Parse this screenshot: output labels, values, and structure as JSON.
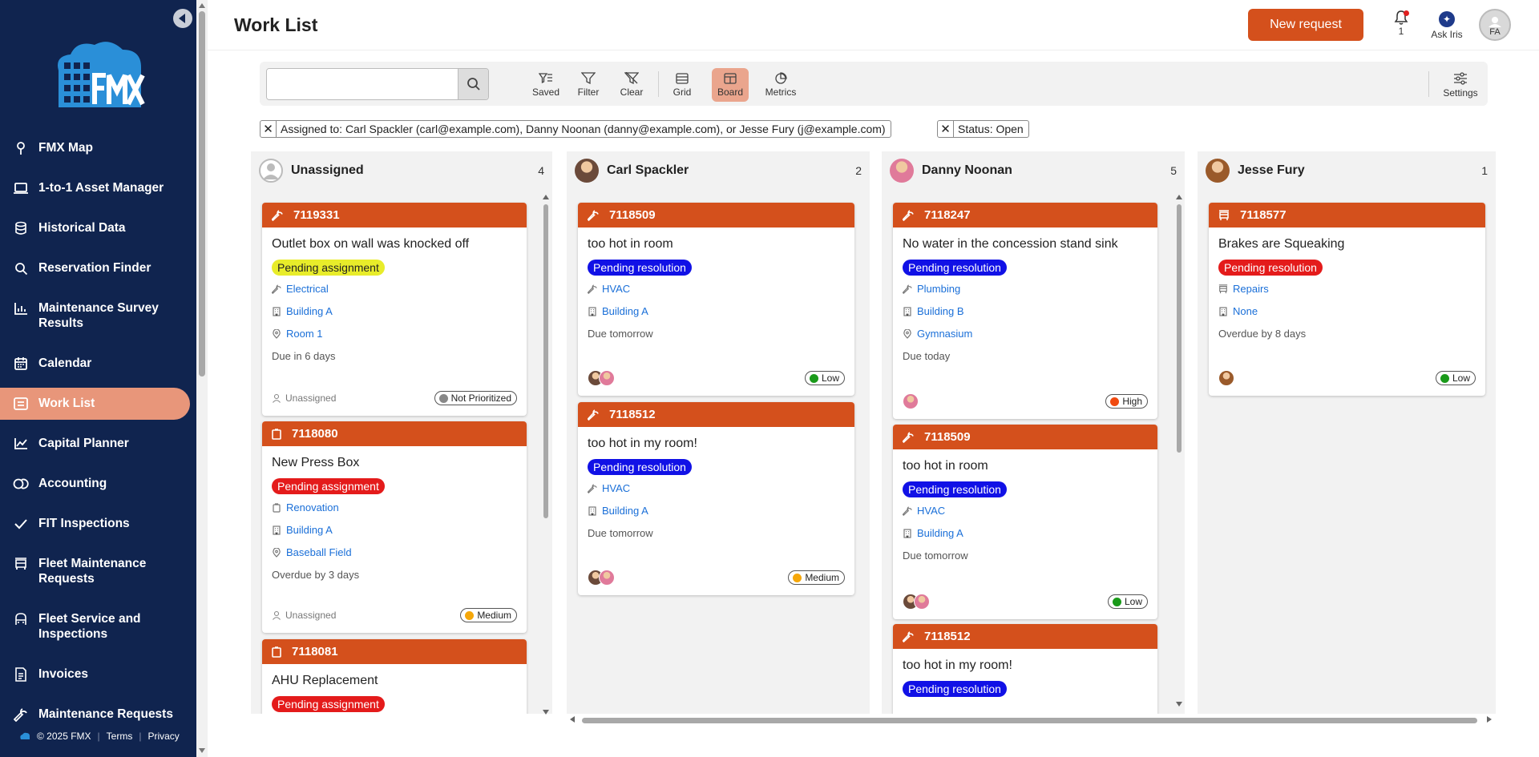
{
  "app": {
    "title": "Work List"
  },
  "sidebar": {
    "items": [
      {
        "label": "FMX Map",
        "icon": "map-pin-icon"
      },
      {
        "label": "1-to-1 Asset Manager",
        "icon": "laptop-icon"
      },
      {
        "label": "Historical Data",
        "icon": "database-icon"
      },
      {
        "label": "Reservation Finder",
        "icon": "search-icon"
      },
      {
        "label": "Maintenance Survey Results",
        "icon": "bar-chart-icon"
      },
      {
        "label": "Calendar",
        "icon": "calendar-icon"
      },
      {
        "label": "Work List",
        "icon": "list-icon",
        "active": true
      },
      {
        "label": "Capital Planner",
        "icon": "line-chart-icon"
      },
      {
        "label": "Accounting",
        "icon": "coins-icon"
      },
      {
        "label": "FIT Inspections",
        "icon": "check-icon"
      },
      {
        "label": "Fleet Maintenance Requests",
        "icon": "bus-icon"
      },
      {
        "label": "Fleet Service and Inspections",
        "icon": "vehicle-icon"
      },
      {
        "label": "Invoices",
        "icon": "invoice-icon"
      },
      {
        "label": "Maintenance Requests",
        "icon": "wrench-icon"
      }
    ],
    "footer": {
      "copyright": "© 2025 FMX",
      "terms": "Terms",
      "privacy": "Privacy"
    }
  },
  "header": {
    "new_request": "New request",
    "notifications_count": "1",
    "ask_iris": "Ask Iris",
    "user_initials": "FA"
  },
  "toolbar": {
    "search_placeholder": "",
    "saved": "Saved",
    "filter": "Filter",
    "clear": "Clear",
    "grid": "Grid",
    "board": "Board",
    "metrics": "Metrics",
    "settings": "Settings"
  },
  "filters": [
    "Assigned to: Carl Spackler (carl@example.com), Danny Noonan (danny@example.com), or Jesse Fury (j@example.com)",
    "Status: Open"
  ],
  "columns": [
    {
      "name": "Unassigned",
      "count": "4",
      "cards": [
        {
          "id": "7119331",
          "title": "Outlet box on wall was knocked off",
          "status": "Pending assignment",
          "status_color": "yellow",
          "type": "Electrical",
          "building": "Building A",
          "location": "Room 1",
          "due": "Due in 6 days",
          "assignee": "Unassigned",
          "priority": "Not Prioritized",
          "priority_color": "#888888"
        },
        {
          "id": "7118080",
          "title": "New Press Box",
          "status": "Pending assignment",
          "status_color": "red",
          "type": "Renovation",
          "building": "Building A",
          "location": "Baseball Field",
          "due": "Overdue by 3 days",
          "assignee": "Unassigned",
          "priority": "Medium",
          "priority_color": "#f5a70a"
        },
        {
          "id": "7118081",
          "title": "AHU Replacement",
          "status": "Pending assignment",
          "status_color": "red"
        }
      ]
    },
    {
      "name": "Carl Spackler",
      "count": "2",
      "cards": [
        {
          "id": "7118509",
          "title": "too hot in room",
          "status": "Pending resolution",
          "status_color": "blue",
          "type": "HVAC",
          "building": "Building A",
          "due": "Due tomorrow",
          "priority": "Low",
          "priority_color": "#1a9a1a"
        },
        {
          "id": "7118512",
          "title": "too hot in my room!",
          "status": "Pending resolution",
          "status_color": "blue",
          "type": "HVAC",
          "building": "Building A",
          "due": "Due tomorrow",
          "priority": "Medium",
          "priority_color": "#f5a70a"
        }
      ]
    },
    {
      "name": "Danny Noonan",
      "count": "5",
      "cards": [
        {
          "id": "7118247",
          "title": "No water in the concession stand sink",
          "status": "Pending resolution",
          "status_color": "blue",
          "type": "Plumbing",
          "building": "Building B",
          "location": "Gymnasium",
          "due": "Due today",
          "priority": "High",
          "priority_color": "#f04a10"
        },
        {
          "id": "7118509",
          "title": "too hot in room",
          "status": "Pending resolution",
          "status_color": "blue",
          "type": "HVAC",
          "building": "Building A",
          "due": "Due tomorrow",
          "priority": "Low",
          "priority_color": "#1a9a1a"
        },
        {
          "id": "7118512",
          "title": "too hot in my room!",
          "status": "Pending resolution",
          "status_color": "blue"
        }
      ]
    },
    {
      "name": "Jesse Fury",
      "count": "1",
      "cards": [
        {
          "id": "7118577",
          "title": "Brakes are Squeaking",
          "status": "Pending resolution",
          "status_color": "red",
          "type": "Repairs",
          "building": "None",
          "due": "Overdue by 8 days",
          "priority": "Low",
          "priority_color": "#1a9a1a"
        }
      ]
    }
  ],
  "colors": {
    "accent": "#d4501c",
    "sidebar": "#10244f",
    "active_nav": "#e8967a"
  }
}
